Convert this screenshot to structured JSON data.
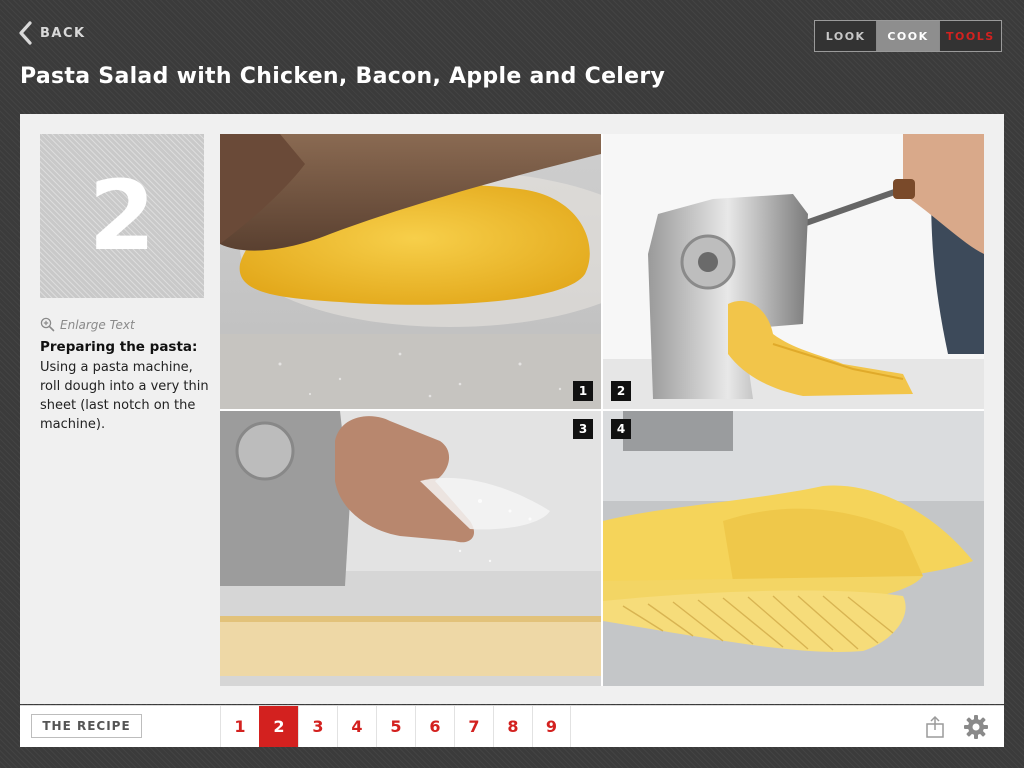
{
  "header": {
    "back_label": "BACK",
    "modes": [
      {
        "label": "LOOK",
        "active": false
      },
      {
        "label": "COOK",
        "active": true
      },
      {
        "label": "TOOLS",
        "active": false
      }
    ],
    "title": "Pasta Salad with Chicken, Bacon, Apple and Celery"
  },
  "step": {
    "number": "2",
    "enlarge_label": "Enlarge Text",
    "heading": "Preparing the pasta:",
    "text": "Using a pasta machine, roll dough into a very thin sheet (last notch on the machine)."
  },
  "photos": [
    {
      "badge": "1",
      "subject": "rolling pasta dough with rolling pin"
    },
    {
      "badge": "2",
      "subject": "pasta sheet coming out of pasta machine"
    },
    {
      "badge": "3",
      "subject": "hand dusting flour over pasta sheet"
    },
    {
      "badge": "4",
      "subject": "folded thin pasta sheets"
    }
  ],
  "footer": {
    "recipe_label": "THE RECIPE",
    "pages": [
      "1",
      "2",
      "3",
      "4",
      "5",
      "6",
      "7",
      "8",
      "9"
    ],
    "current_page": "2"
  },
  "colors": {
    "accent_red": "#d3211f",
    "background_dark": "#3b3b3b",
    "panel": "#f0f0f0",
    "segment_active": "#8e8e8e"
  },
  "icons": {
    "back": "chevron-left-icon",
    "enlarge": "zoom-in-icon",
    "share": "share-icon",
    "settings": "gear-icon"
  }
}
